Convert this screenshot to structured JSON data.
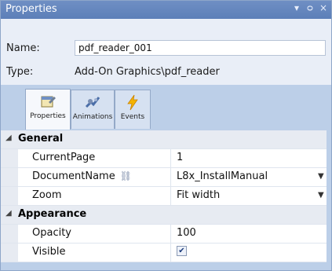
{
  "window": {
    "title": "Properties"
  },
  "titlebar_buttons": {
    "dropdown": "▾",
    "pin": "ᵖ",
    "close": "×"
  },
  "header": {
    "name_label": "Name:",
    "name_value": "pdf_reader_001",
    "type_label": "Type:",
    "type_value": "Add-On Graphics\\pdf_reader"
  },
  "tabs": [
    {
      "label": "Properties",
      "icon": "properties-icon",
      "active": true
    },
    {
      "label": "Animations",
      "icon": "animations-icon",
      "active": false
    },
    {
      "label": "Events",
      "icon": "events-icon",
      "active": false
    }
  ],
  "grid": {
    "categories": [
      {
        "name": "General",
        "props": [
          {
            "name": "CurrentPage",
            "value": "1"
          },
          {
            "name": "DocumentName",
            "value": "L8x_InstallManual",
            "dropdown": true,
            "link_icon": true
          },
          {
            "name": "Zoom",
            "value": "Fit width",
            "dropdown": true
          }
        ]
      },
      {
        "name": "Appearance",
        "props": [
          {
            "name": "Opacity",
            "value": "100"
          },
          {
            "name": "Visible",
            "checked": true
          }
        ]
      }
    ]
  },
  "colors": {
    "accent": "#5c7fb8",
    "panel_bg": "#bccfe8",
    "header_bg": "#e9eef7"
  }
}
